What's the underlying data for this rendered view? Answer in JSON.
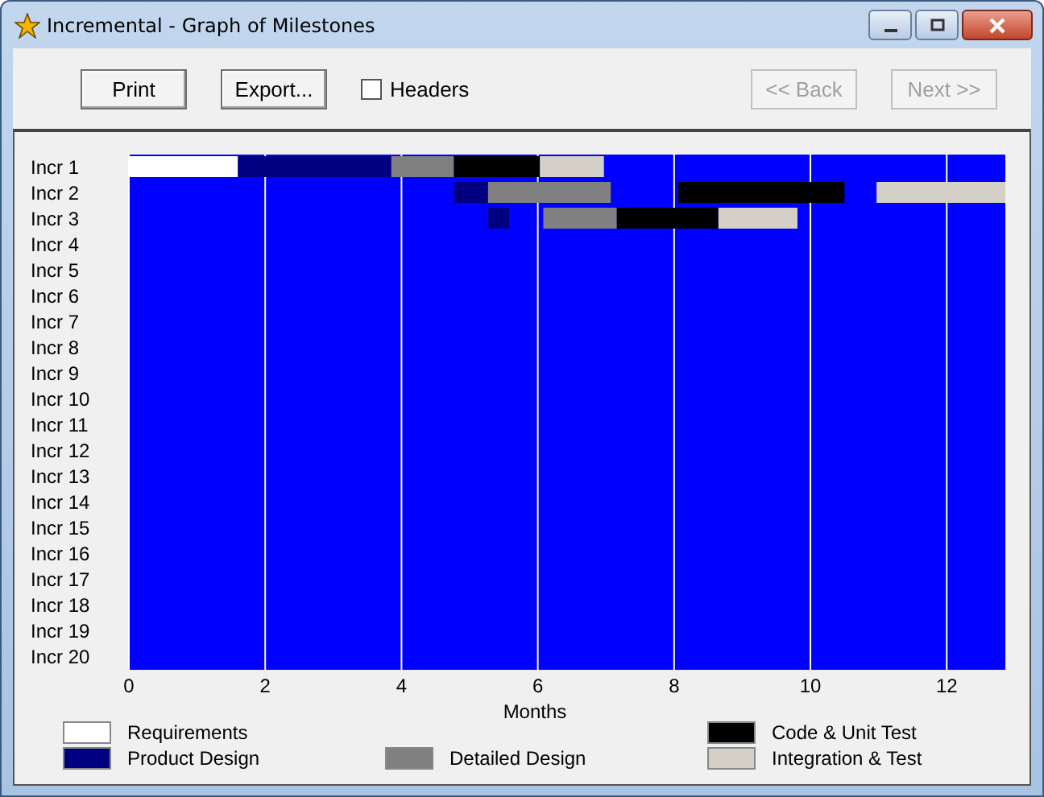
{
  "window": {
    "title": "Incremental - Graph of Milestones"
  },
  "toolbar": {
    "buttons": [
      {
        "label": "Print",
        "disabled": false
      },
      {
        "label": "Export...",
        "disabled": false
      }
    ],
    "headers": {
      "label": "Headers",
      "checked": false
    },
    "nav": [
      {
        "label": "<< Back",
        "disabled": true
      },
      {
        "label": "Next >>",
        "disabled": true
      }
    ]
  },
  "chart": {
    "chart_data": {
      "type": "bar",
      "orientation": "horizontal",
      "grid": true,
      "xlabel": "Months",
      "xlim": [
        0,
        12.86
      ],
      "xticks": [
        0,
        2,
        4,
        6,
        8,
        10,
        12
      ],
      "categories": [
        "Incr 1",
        "Incr 2",
        "Incr 3",
        "Incr 4",
        "Incr 5",
        "Incr 6",
        "Incr 7",
        "Incr 8",
        "Incr 9",
        "Incr 10",
        "Incr 11",
        "Incr 12",
        "Incr 13",
        "Incr 14",
        "Incr 15",
        "Incr 16",
        "Incr 17",
        "Incr 18",
        "Incr 19",
        "Incr 20"
      ],
      "series": [
        {
          "name": "Requirements",
          "color": "#ffffff",
          "base": [
            0,
            null,
            null,
            null,
            null,
            null,
            null,
            null,
            null,
            null,
            null,
            null,
            null,
            null,
            null,
            null,
            null,
            null,
            null,
            null
          ],
          "values": [
            1.6,
            null,
            null,
            null,
            null,
            null,
            null,
            null,
            null,
            null,
            null,
            null,
            null,
            null,
            null,
            null,
            null,
            null,
            null,
            null
          ]
        },
        {
          "name": "Product Design",
          "color": "#000080",
          "base": [
            1.6,
            4.77,
            5.27,
            null,
            null,
            null,
            null,
            null,
            null,
            null,
            null,
            null,
            null,
            null,
            null,
            null,
            null,
            null,
            null,
            null
          ],
          "values": [
            2.25,
            0.5,
            0.31,
            null,
            null,
            null,
            null,
            null,
            null,
            null,
            null,
            null,
            null,
            null,
            null,
            null,
            null,
            null,
            null,
            null
          ]
        },
        {
          "name": "Detailed Design",
          "color": "#808080",
          "base": [
            3.85,
            5.27,
            6.08,
            null,
            null,
            null,
            null,
            null,
            null,
            null,
            null,
            null,
            null,
            null,
            null,
            null,
            null,
            null,
            null,
            null
          ],
          "values": [
            0.92,
            1.8,
            1.08,
            null,
            null,
            null,
            null,
            null,
            null,
            null,
            null,
            null,
            null,
            null,
            null,
            null,
            null,
            null,
            null,
            null
          ]
        },
        {
          "name": "Code & Unit Test",
          "color": "#000000",
          "base": [
            4.77,
            8.06,
            7.16,
            null,
            null,
            null,
            null,
            null,
            null,
            null,
            null,
            null,
            null,
            null,
            null,
            null,
            null,
            null,
            null,
            null
          ],
          "values": [
            1.26,
            2.44,
            1.49,
            null,
            null,
            null,
            null,
            null,
            null,
            null,
            null,
            null,
            null,
            null,
            null,
            null,
            null,
            null,
            null,
            null
          ]
        },
        {
          "name": "Integration & Test",
          "color": "#d4d0c8",
          "base": [
            6.03,
            10.97,
            8.65,
            null,
            null,
            null,
            null,
            null,
            null,
            null,
            null,
            null,
            null,
            null,
            null,
            null,
            null,
            null,
            null,
            null
          ],
          "values": [
            0.94,
            1.89,
            1.16,
            null,
            null,
            null,
            null,
            null,
            null,
            null,
            null,
            null,
            null,
            null,
            null,
            null,
            null,
            null,
            null,
            null
          ]
        }
      ]
    }
  }
}
